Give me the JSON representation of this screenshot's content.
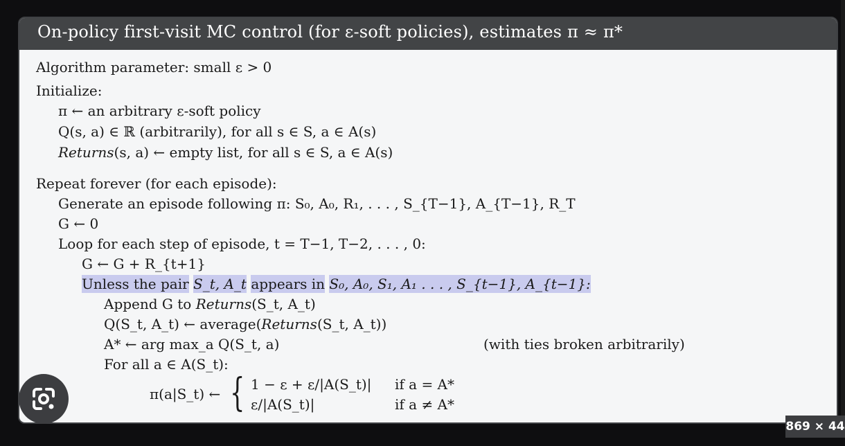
{
  "header": {
    "title": "On-policy first-visit MC control (for ε-soft policies), estimates π ≈ π*"
  },
  "algorithm": {
    "parameter": "Algorithm parameter: small ε > 0",
    "initialize_label": "Initialize:",
    "init_policy": "π ← an arbitrary ε-soft policy",
    "init_q": "Q(s, a) ∈ ℝ (arbitrarily), for all s ∈ S, a ∈ A(s)",
    "init_returns_name": "Returns",
    "init_returns_rest": "(s, a) ← empty list, for all s ∈ S, a ∈ A(s)",
    "repeat_label": "Repeat forever (for each episode):",
    "generate": "Generate an episode following π: S₀, A₀, R₁, . . . , S_{T−1}, A_{T−1}, R_T",
    "g_init": "G ← 0",
    "loop": "Loop for each step of episode, t = T−1, T−2, . . . , 0:",
    "g_update": "G ← G + R_{t+1}",
    "unless_a": "Unless the pair",
    "unless_b": "S_t, A_t",
    "unless_c": "appears in",
    "unless_d": "S₀, A₀, S₁, A₁ . . . , S_{t−1}, A_{t−1}:",
    "append_a": "Append G to ",
    "append_b": "Returns",
    "append_c": "(S_t, A_t)",
    "q_update_a": "Q(S_t, A_t) ← average(",
    "q_update_b": "Returns",
    "q_update_c": "(S_t, A_t))",
    "astar": "A* ← arg max_a Q(S_t, a)",
    "ties": "(with ties broken arbitrarily)",
    "forall": "For all a ∈ A(S_t):",
    "pi_lhs": "π(a|S_t) ←",
    "case1_val": "1 − ε + ε/|A(S_t)|",
    "case1_cond": "if a = A*",
    "case2_val": "ε/|A(S_t)|",
    "case2_cond": "if a ≠ A*"
  },
  "overlay": {
    "lens_icon": "google-lens-icon",
    "size_badge": "869 × 44"
  },
  "colors": {
    "header_bg": "#424446",
    "card_bg": "#f5f6f7",
    "highlight": "#c9cbee",
    "page_bg": "#0e0e10"
  }
}
